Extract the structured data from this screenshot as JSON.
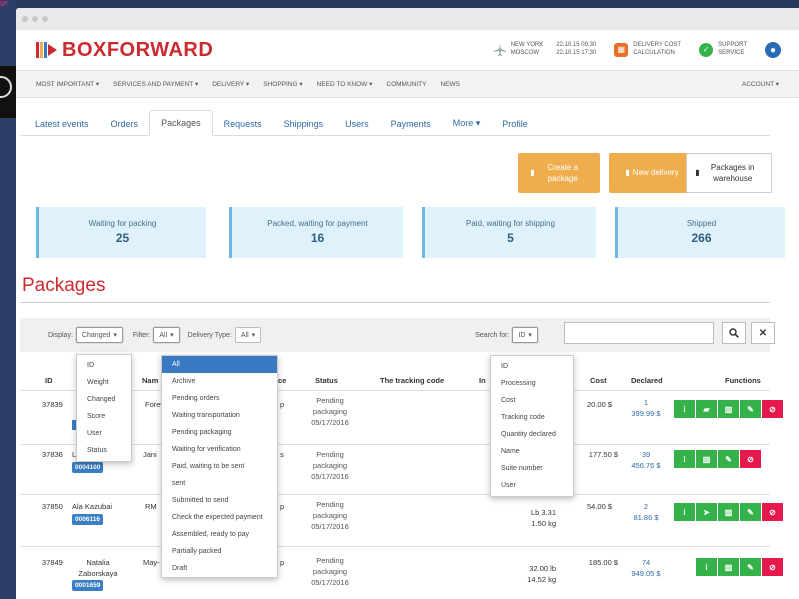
{
  "background": {
    "corner_text": "ge"
  },
  "header": {
    "logo_text": "BOXFORWARD",
    "cities": "NEW YORK\nMOSCOW",
    "times": "22.10.15 09:30\n22.10.15 17:30",
    "delivery_calc": "DELIVERY COST\nCALCULATION",
    "support": "SUPPORT\nSERVICE"
  },
  "mainnav": [
    "MOST IMPORTANT ▾",
    "SERVICES AND PAYMENT ▾",
    "DELIVERY ▾",
    "SHOPPING ▾",
    "NEED TO KNOW ▾",
    "COMMUNITY",
    "NEWS"
  ],
  "account": "ACCOUNT ▾",
  "tabs": [
    "Latest events",
    "Orders",
    "Packages",
    "Requests",
    "Shippings",
    "Users",
    "Payments",
    "More ▾",
    "Profile"
  ],
  "active_tab": "Packages",
  "actions": {
    "create": "Create a package",
    "new_delivery": "New delivery",
    "warehouse": "Packages in warehouse"
  },
  "stats": [
    {
      "label": "Waiting for packing",
      "value": "25"
    },
    {
      "label": "Packed, waiting for payment",
      "value": "16"
    },
    {
      "label": "Paid, waiting for shipping",
      "value": "5"
    },
    {
      "label": "Shipped",
      "value": "266"
    }
  ],
  "section_title": "Packages",
  "filters": {
    "display_label": "Display:",
    "display_value": "Changed",
    "filter_label": "Filter:",
    "filter_value": "All",
    "delivery_label": "Delivery Type:",
    "delivery_value": "All",
    "search_label": "Search for:",
    "search_value": "ID",
    "search_placeholder": ""
  },
  "columns": {
    "id": "ID",
    "name": "Nam",
    "ce": "ce",
    "status": "Status",
    "tracking": "The tracking code",
    "in": "In",
    "cost": "Cost",
    "declared": "Declared",
    "functions": "Functions"
  },
  "rows": [
    {
      "id": "37839",
      "name": "Forever2",
      "ce": "p",
      "badge": "",
      "status": "Pending packaging 05/17/2016",
      "weight": "",
      "cost": "20.00 $",
      "declared_count": "1",
      "declared_amount": "399.99 $"
    },
    {
      "id": "37836",
      "name": "Jani",
      "prefix": "L",
      "ce": "s",
      "badge": "0004100",
      "status": "Pending packaging 05/17/2016",
      "weight": "",
      "cost": "177.50 $",
      "declared_count": "39",
      "declared_amount": "456.76 $"
    },
    {
      "id": "37850",
      "name": "Ala Kazubai",
      "second": "RM",
      "ce": "p",
      "badge": "0006116",
      "status": "Pending packaging 05/17/2016",
      "weight": "Lb 3.31\n1.50 kg",
      "cost": "54.00 $",
      "declared_count": "2",
      "declared_amount": "81.86 $"
    },
    {
      "id": "37849",
      "name": "Natalia Zaborskaya",
      "second": "May-",
      "ce": "p",
      "badge": "0001659",
      "status": "Pending packaging 05/17/2016",
      "weight": "32.00 lb\n14.52 kg",
      "cost": "185.00 $",
      "declared_count": "74",
      "declared_amount": "949.05 $"
    }
  ],
  "dropdown_display": [
    "ID",
    "Weight",
    "Changed",
    "Score",
    "User",
    "Status"
  ],
  "dropdown_filter": [
    "All",
    "Archive",
    "Pending orders",
    "Waiting transportation",
    "Pending packaging",
    "Waiting for verification",
    "Paid, waiting to be sent",
    "sent",
    "Submitted to send",
    "Check the expected payment",
    "Assembled, ready to pay",
    "Partially packed",
    "Draft"
  ],
  "dropdown_search": [
    "ID",
    "Processing",
    "Cost",
    "Tracking code",
    "Quantity declared",
    "Name",
    "Suite number",
    "User"
  ],
  "colors": {
    "brand_red": "#cc2a2f",
    "orange": "#f0ad4e",
    "green": "#35b34a",
    "red": "#e5194c",
    "blue": "#3a78c2",
    "stat_bg": "#dff1fa"
  }
}
